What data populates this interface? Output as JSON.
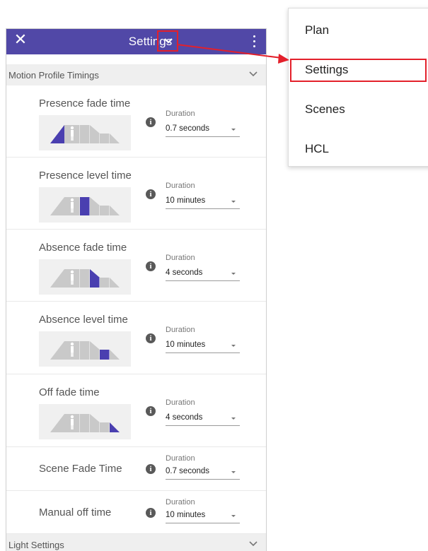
{
  "appbar": {
    "title": "Settings",
    "close_icon": "close-icon",
    "dropdown_icon": "chevron-down-icon",
    "more_icon": "more-vert-icon",
    "color": "#5148a7"
  },
  "sections": {
    "motion": {
      "label": "Motion Profile Timings"
    },
    "light": {
      "label": "Light Settings"
    }
  },
  "settings": [
    {
      "name": "Presence fade time",
      "duration_label": "Duration",
      "value": "0.7 seconds",
      "highlight": "presence-fade"
    },
    {
      "name": "Presence level time",
      "duration_label": "Duration",
      "value": "10 minutes",
      "highlight": "presence-level"
    },
    {
      "name": "Absence fade time",
      "duration_label": "Duration",
      "value": "4 seconds",
      "highlight": "absence-fade"
    },
    {
      "name": "Absence level time",
      "duration_label": "Duration",
      "value": "10 minutes",
      "highlight": "absence-level"
    },
    {
      "name": "Off fade time",
      "duration_label": "Duration",
      "value": "4 seconds",
      "highlight": "off-fade"
    },
    {
      "name": "Scene Fade Time",
      "duration_label": "Duration",
      "value": "0.7 seconds"
    },
    {
      "name": "Manual off time",
      "duration_label": "Duration",
      "value": "10 minutes"
    }
  ],
  "menu": {
    "items": [
      "Plan",
      "Settings",
      "Scenes",
      "HCL"
    ],
    "selected": "Settings",
    "annotation_color": "#e3202b"
  },
  "colors": {
    "accent": "#4a3fb0",
    "diagram_grey": "#c9c9c9",
    "diagram_bg": "#f0f0f0"
  }
}
